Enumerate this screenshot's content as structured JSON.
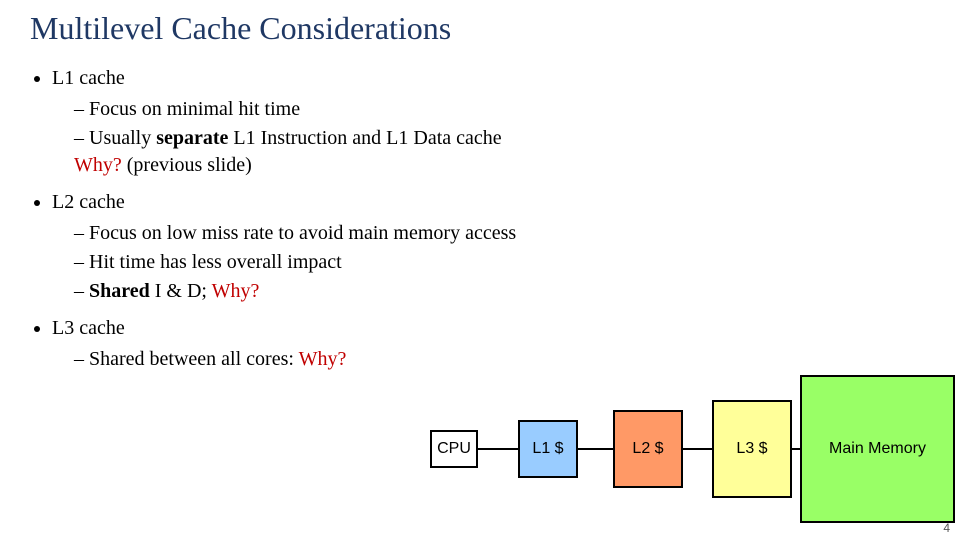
{
  "title": "Multilevel Cache Considerations",
  "lvl1": {
    "i0": "L1 cache",
    "i1": "L2 cache",
    "i2": "L3 cache"
  },
  "l1sub": {
    "a": "Focus on minimal hit time",
    "b_pre": "Usually ",
    "b_bold": "separate",
    "b_post": " L1 Instruction and L1 Data cache",
    "c_why": "Why?",
    "c_rest": " (previous slide)"
  },
  "l2sub": {
    "a": "Focus on low miss rate to avoid main memory access",
    "b": "Hit time has less overall impact",
    "c_pre_bold": "Shared",
    "c_mid": " I & D; ",
    "c_why": "Why?"
  },
  "l3sub": {
    "a_pre": "Shared between all cores: ",
    "a_why": "Why?"
  },
  "diagram": {
    "cpu": "CPU",
    "l1": "L1 $",
    "l2": "L2 $",
    "l3": "L3 $",
    "mm": "Main Memory"
  },
  "slidenum": "4"
}
